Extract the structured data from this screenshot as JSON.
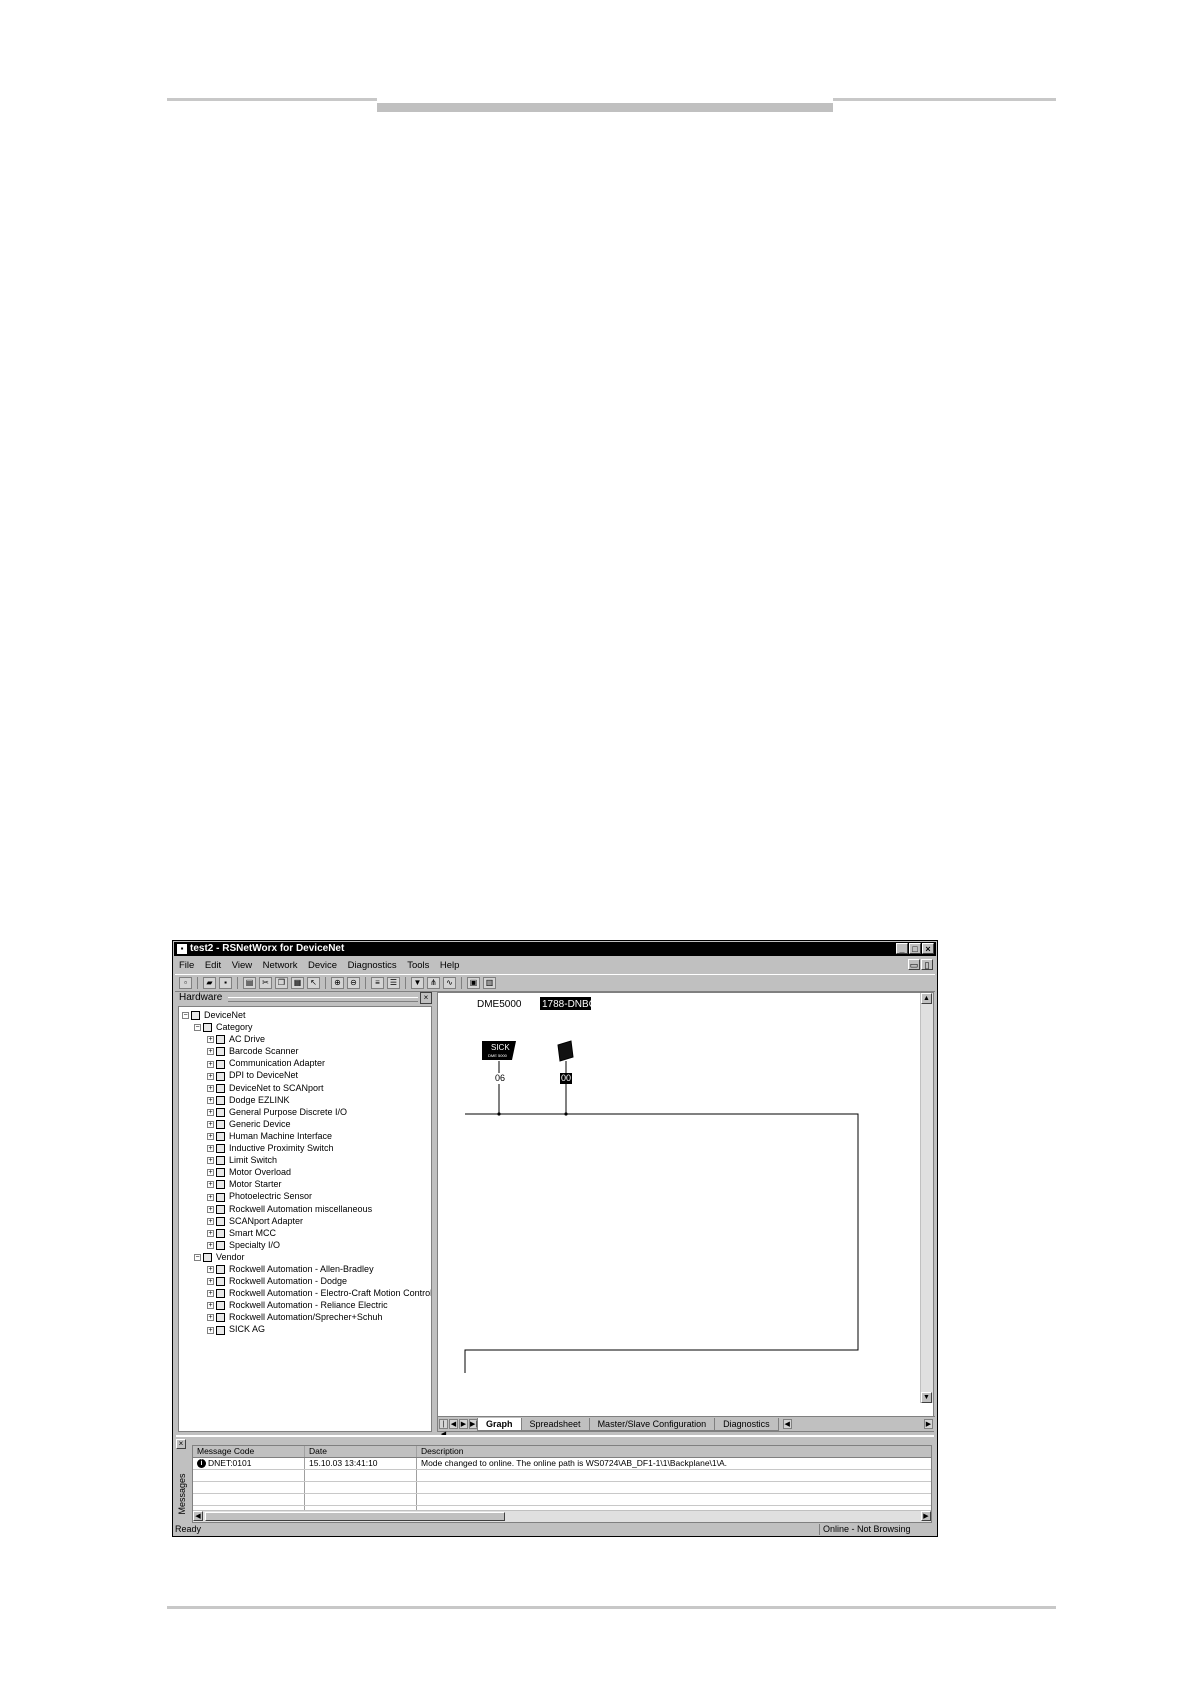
{
  "window": {
    "title": "test2 - RSNetWorx for DeviceNet"
  },
  "menu": [
    "File",
    "Edit",
    "View",
    "Network",
    "Device",
    "Diagnostics",
    "Tools",
    "Help"
  ],
  "hardware": {
    "header": "Hardware",
    "root": "DeviceNet",
    "category_label": "Category",
    "categories": [
      "AC Drive",
      "Barcode Scanner",
      "Communication Adapter",
      "DPI to DeviceNet",
      "DeviceNet to SCANport",
      "Dodge EZLINK",
      "General Purpose Discrete I/O",
      "Generic Device",
      "Human Machine Interface",
      "Inductive Proximity Switch",
      "Limit Switch",
      "Motor Overload",
      "Motor Starter",
      "Photoelectric Sensor",
      "Rockwell Automation miscellaneous",
      "SCANport Adapter",
      "Smart MCC",
      "Specialty I/O"
    ],
    "vendor_label": "Vendor",
    "vendors": [
      "Rockwell Automation - Allen-Bradley",
      "Rockwell Automation - Dodge",
      "Rockwell Automation - Electro-Craft Motion Control",
      "Rockwell Automation - Reliance Electric",
      "Rockwell Automation/Sprecher+Schuh",
      "SICK AG"
    ]
  },
  "graph": {
    "device1": {
      "name": "DME5000",
      "logo": "SICK",
      "sublogo": "DME 5000",
      "address": "06"
    },
    "device2": {
      "name": "1788-DNBO",
      "address": "00"
    },
    "tabs": [
      "Graph",
      "Spreadsheet",
      "Master/Slave Configuration",
      "Diagnostics"
    ]
  },
  "messages": {
    "side_label": "Messages",
    "columns": [
      "Message Code",
      "Date",
      "Description"
    ],
    "rows": [
      {
        "code": "DNET:0101",
        "date": "15.10.03 13:41:10",
        "description": "Mode changed to online.  The online path is WS0724\\AB_DF1-1\\1\\Backplane\\1\\A."
      }
    ]
  },
  "status": {
    "left": "Ready",
    "right": "Online - Not Browsing"
  }
}
